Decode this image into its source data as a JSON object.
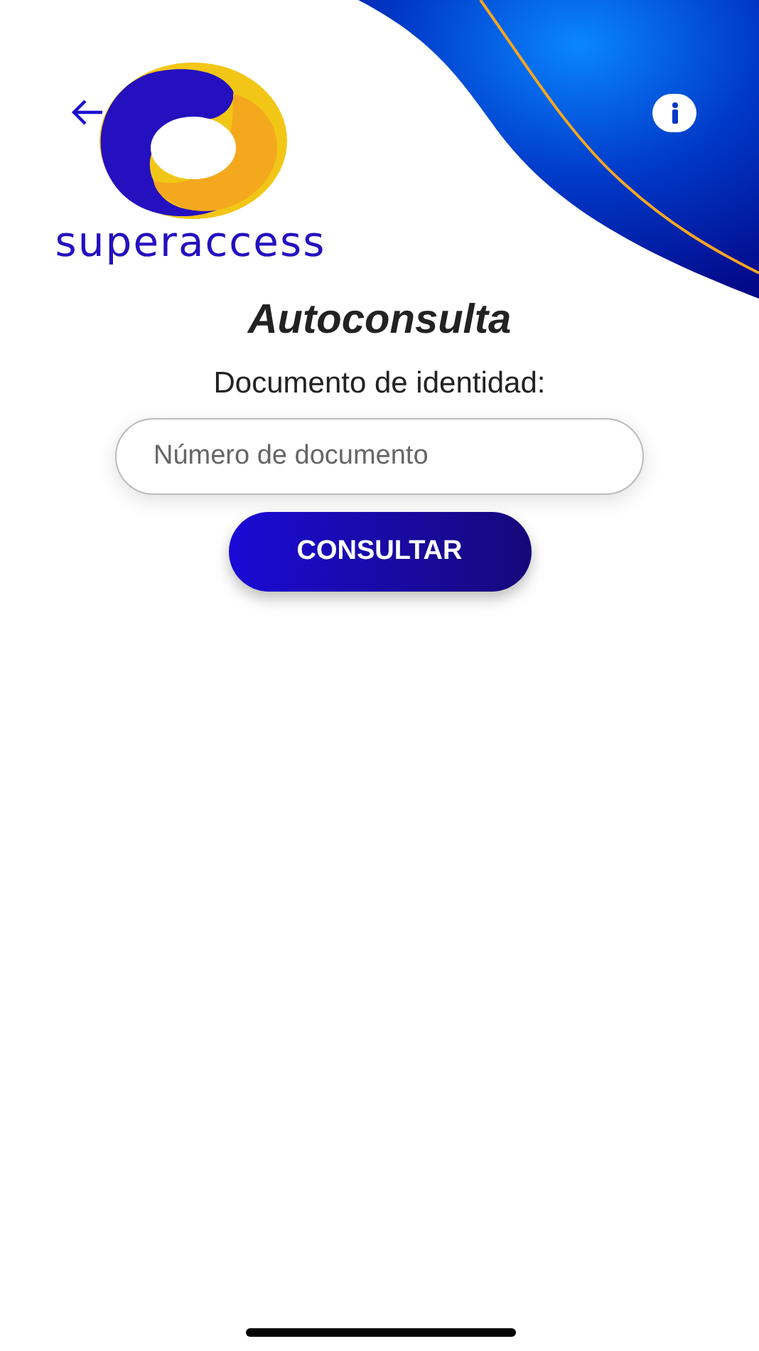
{
  "logo": {
    "wordmark": "superaccess"
  },
  "title": "Autoconsulta",
  "field_label": "Documento de identidad:",
  "document_field": {
    "placeholder": "Número de documento"
  },
  "submit_button": {
    "label": "CONSULTAR"
  }
}
